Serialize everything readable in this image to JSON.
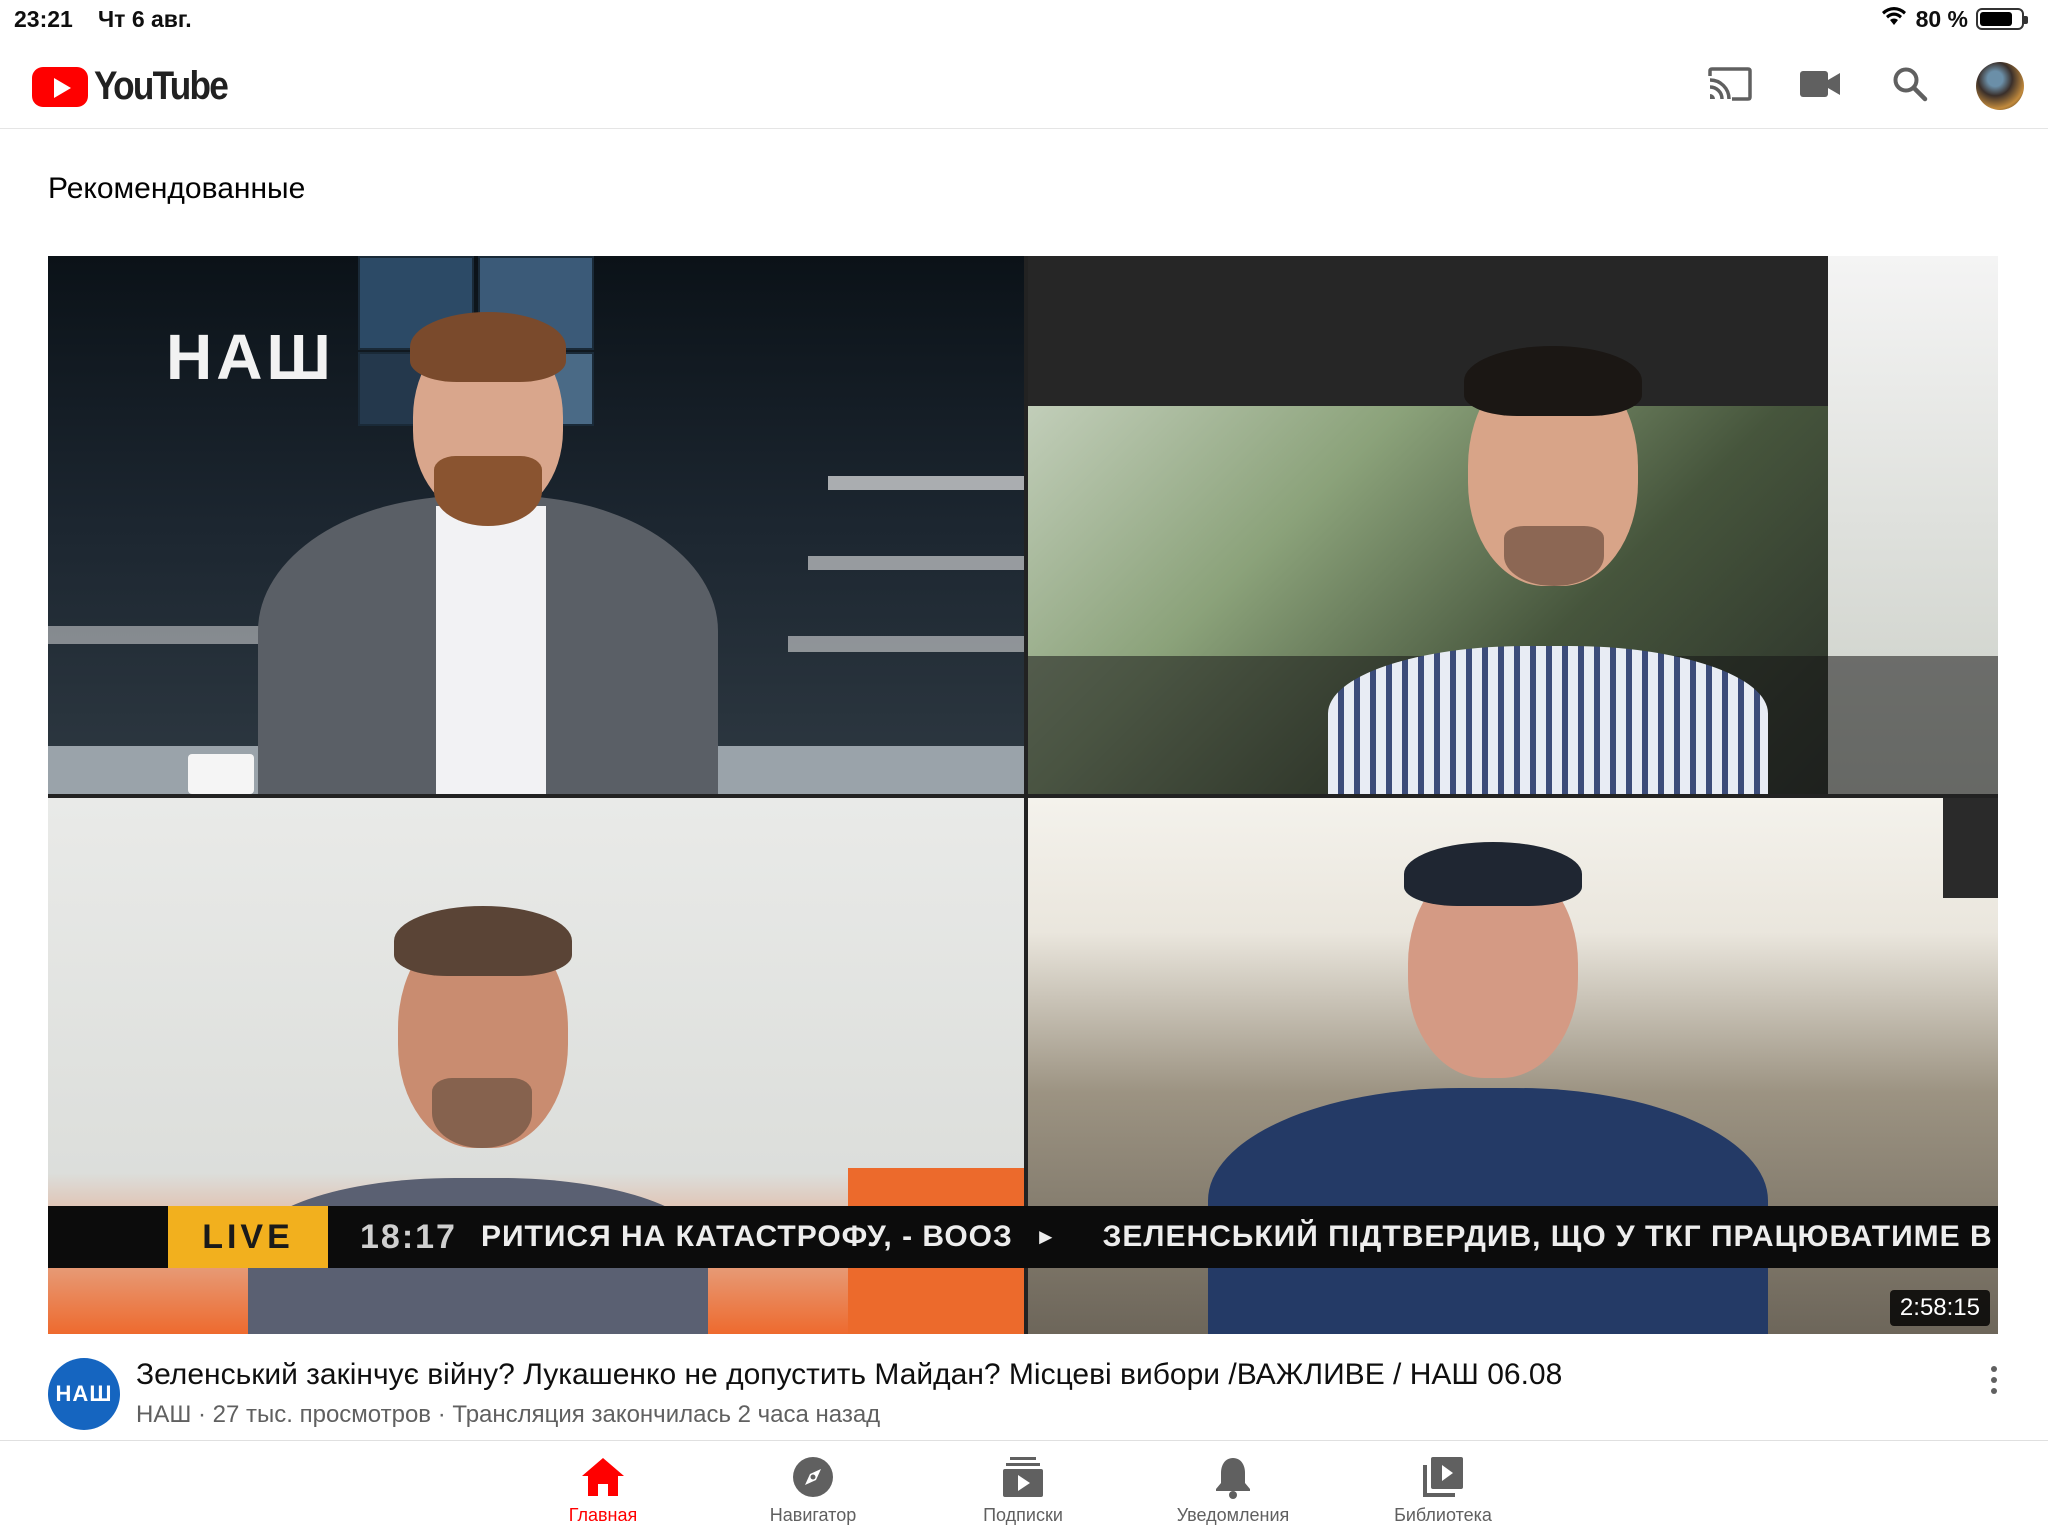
{
  "status_bar": {
    "time": "23:21",
    "date": "Чт 6 авг.",
    "battery": "80 %",
    "battery_level": 0.8
  },
  "header": {
    "logo_text": "YouTube",
    "actions": [
      {
        "name": "cast-icon"
      },
      {
        "name": "video-camera-icon"
      },
      {
        "name": "search-icon"
      },
      {
        "name": "account-avatar"
      }
    ]
  },
  "section": {
    "title": "Рекомендованные"
  },
  "video": {
    "studio_logo": "НАШ",
    "ticker_live": "LIVE",
    "ticker_time": "18:17",
    "ticker_text_1": "РИТИСЯ НА КАТАСТРОФУ, - ВООЗ",
    "ticker_text_2": "ЗЕЛЕНСЬКИЙ ПІДТВЕРДИВ, ЩО У ТКГ ПРАЦЮВАТИМЕ В",
    "duration": "2:58:15",
    "channel_avatar_text": "НАШ",
    "title": "Зеленський закінчує війну? Лукашенко не допустить Майдан? Місцеві вибори /ВАЖЛИВЕ / НАШ 06.08",
    "meta": "НАШ · 27 тыс. просмотров · Трансляция закончилась 2 часа назад"
  },
  "bottom_nav": {
    "items": [
      {
        "label": "Главная",
        "icon": "home-icon",
        "active": true
      },
      {
        "label": "Навигатор",
        "icon": "compass-icon",
        "active": false
      },
      {
        "label": "Подписки",
        "icon": "subscriptions-icon",
        "active": false
      },
      {
        "label": "Уведомления",
        "icon": "bell-icon",
        "active": false
      },
      {
        "label": "Библиотека",
        "icon": "library-icon",
        "active": false
      }
    ]
  },
  "colors": {
    "brand_red": "#ff0000",
    "channel_blue": "#1565c0",
    "ticker_yellow": "#f2b01e",
    "secondary_text": "#606060"
  }
}
